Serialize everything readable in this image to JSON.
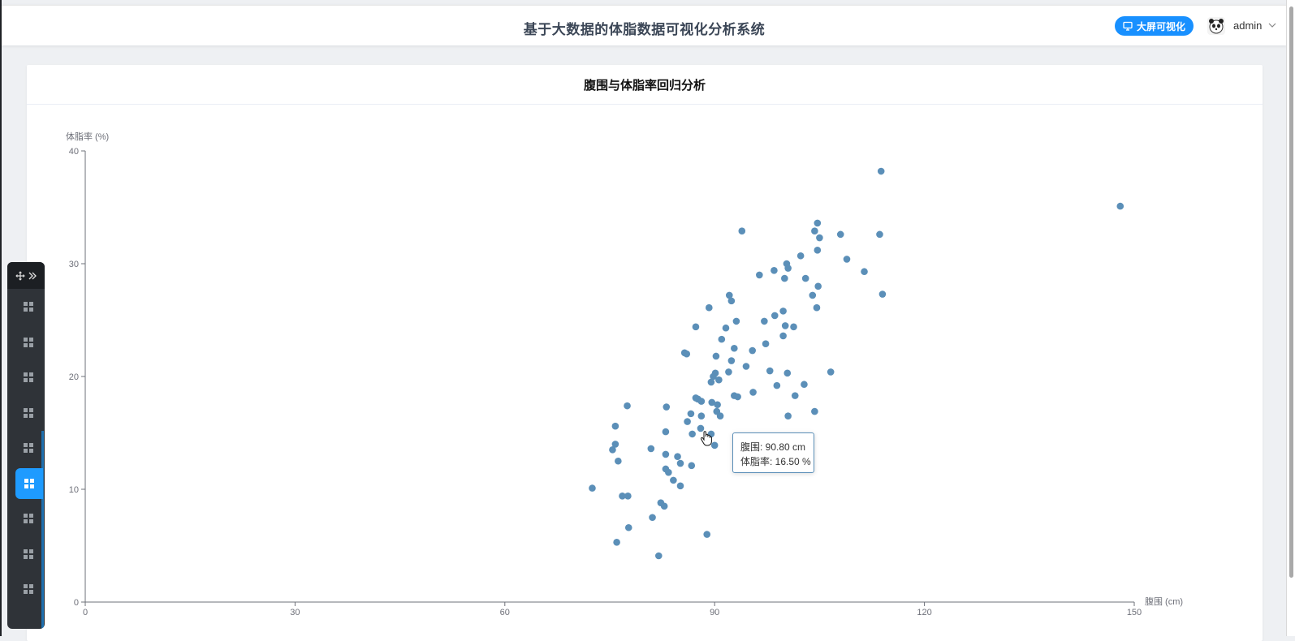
{
  "header": {
    "title": "基于大数据的体脂数据可视化分析系统",
    "bigscreen_label": "大屏可视化",
    "user": "admin",
    "accent": "#1890ff"
  },
  "card": {
    "title": "腹围与体脂率回归分析"
  },
  "tooltip": {
    "line1": "腹围: 90.80 cm",
    "line2": "体脂率: 16.50 %"
  },
  "float_nav": {
    "item_count": 9,
    "active_index": 5,
    "active_color": "#1e9bff"
  },
  "chart_data": {
    "type": "scatter",
    "xlabel": "腹围 (cm)",
    "ylabel": "体脂率 (%)",
    "xlim": [
      0,
      150
    ],
    "ylim": [
      0,
      40
    ],
    "xticks": [
      "0",
      "30",
      "60",
      "90",
      "120",
      "150"
    ],
    "yticks": [
      "0",
      "10",
      "20",
      "30",
      "40"
    ],
    "color": "#5b8fb8",
    "points": [
      [
        113.8,
        38.2
      ],
      [
        148.0,
        35.1
      ],
      [
        93.9,
        32.9
      ],
      [
        104.7,
        33.6
      ],
      [
        104.3,
        32.9
      ],
      [
        108.0,
        32.6
      ],
      [
        113.6,
        32.6
      ],
      [
        105.0,
        32.3
      ],
      [
        104.7,
        31.2
      ],
      [
        102.3,
        30.7
      ],
      [
        108.9,
        30.4
      ],
      [
        100.3,
        30.0
      ],
      [
        100.5,
        29.6
      ],
      [
        111.4,
        29.3
      ],
      [
        98.5,
        29.4
      ],
      [
        96.4,
        29.0
      ],
      [
        100.0,
        28.7
      ],
      [
        103.0,
        28.7
      ],
      [
        104.8,
        28.0
      ],
      [
        104.0,
        27.2
      ],
      [
        114.0,
        27.3
      ],
      [
        92.1,
        27.2
      ],
      [
        92.4,
        26.7
      ],
      [
        89.2,
        26.1
      ],
      [
        104.6,
        26.1
      ],
      [
        99.8,
        25.8
      ],
      [
        98.6,
        25.4
      ],
      [
        97.1,
        24.9
      ],
      [
        93.1,
        24.9
      ],
      [
        87.3,
        24.4
      ],
      [
        91.6,
        24.3
      ],
      [
        100.1,
        24.5
      ],
      [
        101.3,
        24.4
      ],
      [
        99.8,
        23.6
      ],
      [
        91.0,
        23.3
      ],
      [
        97.3,
        22.9
      ],
      [
        92.8,
        22.5
      ],
      [
        95.4,
        22.3
      ],
      [
        85.7,
        22.1
      ],
      [
        86.0,
        22.0
      ],
      [
        90.2,
        21.8
      ],
      [
        92.4,
        21.4
      ],
      [
        94.5,
        20.9
      ],
      [
        90.1,
        20.3
      ],
      [
        92.0,
        20.4
      ],
      [
        97.9,
        20.5
      ],
      [
        100.4,
        20.3
      ],
      [
        106.6,
        20.4
      ],
      [
        89.8,
        20.0
      ],
      [
        90.6,
        19.7
      ],
      [
        89.5,
        19.5
      ],
      [
        98.9,
        19.2
      ],
      [
        102.8,
        19.3
      ],
      [
        95.5,
        18.6
      ],
      [
        92.8,
        18.3
      ],
      [
        93.3,
        18.2
      ],
      [
        101.5,
        18.3
      ],
      [
        87.3,
        18.1
      ],
      [
        87.6,
        18.0
      ],
      [
        88.1,
        17.8
      ],
      [
        89.6,
        17.7
      ],
      [
        90.4,
        17.5
      ],
      [
        77.5,
        17.4
      ],
      [
        83.1,
        17.3
      ],
      [
        104.3,
        16.9
      ],
      [
        86.6,
        16.7
      ],
      [
        90.3,
        16.9
      ],
      [
        90.8,
        16.5
      ],
      [
        88.1,
        16.5
      ],
      [
        100.5,
        16.5
      ],
      [
        86.1,
        16.0
      ],
      [
        75.8,
        15.6
      ],
      [
        88.0,
        15.4
      ],
      [
        83.0,
        15.1
      ],
      [
        86.8,
        14.9
      ],
      [
        89.5,
        14.9
      ],
      [
        75.8,
        14.0
      ],
      [
        90.0,
        13.9
      ],
      [
        75.4,
        13.5
      ],
      [
        80.9,
        13.6
      ],
      [
        83.0,
        13.1
      ],
      [
        84.7,
        12.9
      ],
      [
        76.2,
        12.5
      ],
      [
        85.1,
        12.3
      ],
      [
        86.7,
        12.1
      ],
      [
        83.0,
        11.8
      ],
      [
        83.4,
        11.5
      ],
      [
        84.1,
        10.8
      ],
      [
        72.5,
        10.1
      ],
      [
        85.1,
        10.3
      ],
      [
        76.8,
        9.4
      ],
      [
        77.6,
        9.4
      ],
      [
        82.3,
        8.8
      ],
      [
        82.8,
        8.5
      ],
      [
        81.1,
        7.5
      ],
      [
        77.7,
        6.6
      ],
      [
        88.9,
        6.0
      ],
      [
        76.0,
        5.3
      ],
      [
        82.0,
        4.1
      ]
    ]
  }
}
